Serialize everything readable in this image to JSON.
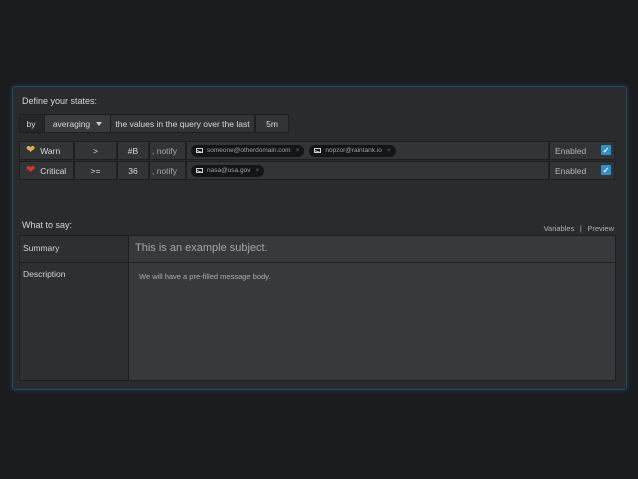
{
  "states": {
    "title": "Define your states:",
    "by_label": "by",
    "aggregate": "averaging",
    "query_text": "the values in the query over the last",
    "window": "5m",
    "rows": [
      {
        "state": "Warn",
        "icon": "yellow-heart-icon",
        "color": "#d9b34a",
        "operator": ">",
        "threshold": "#B",
        "notify_label": ", notify",
        "emails": [
          "someone@otherdomain.com",
          "nopzor@raintank.io"
        ],
        "enabled_label": "Enabled",
        "enabled": true
      },
      {
        "state": "Critical",
        "icon": "red-heart-icon",
        "color": "#d9342f",
        "operator": ">=",
        "threshold": "36",
        "notify_label": ", notify",
        "emails": [
          "nasa@usa.gov"
        ],
        "enabled_label": "Enabled",
        "enabled": true
      }
    ]
  },
  "message": {
    "title": "What to say:",
    "variables_link": "Variables",
    "separator": "|",
    "preview_link": "Preview",
    "summary_label": "Summary",
    "summary_value": "This is an example subject.",
    "description_label": "Description",
    "description_value": "We will have a pre-filled message body."
  }
}
